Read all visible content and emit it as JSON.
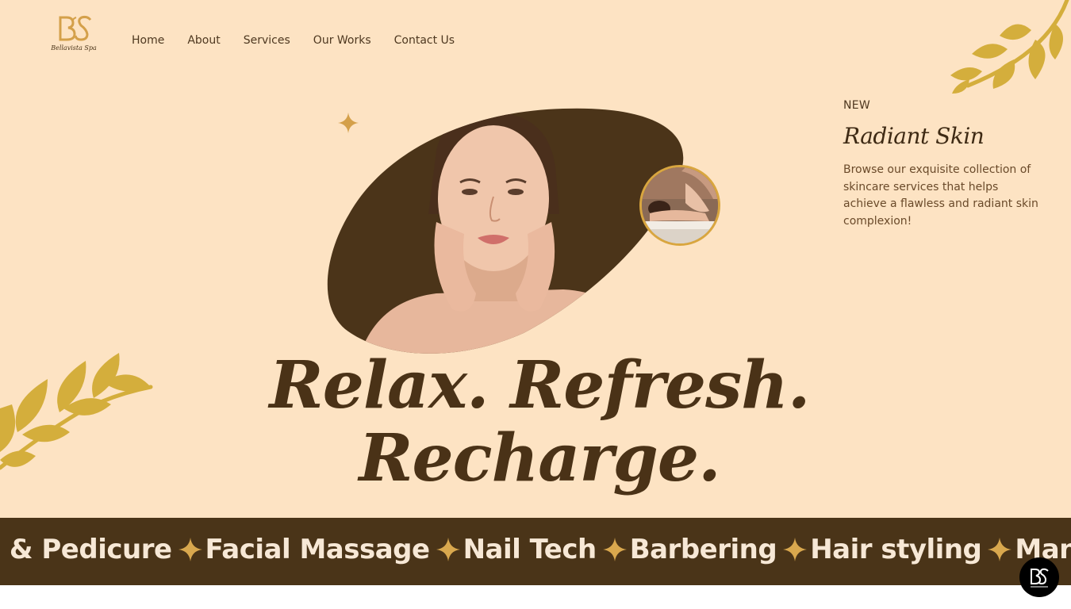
{
  "brand": {
    "monogram": "BS",
    "name": "Bellavista Spa"
  },
  "nav": {
    "items": [
      {
        "label": "Home"
      },
      {
        "label": "About"
      },
      {
        "label": "Services"
      },
      {
        "label": "Our Works"
      },
      {
        "label": "Contact Us"
      }
    ]
  },
  "promo": {
    "tag": "NEW",
    "title": "Radiant Skin",
    "description": "Browse our exquisite collection of skincare services that helps achieve a flawless and radiant skin complexion!"
  },
  "hero": {
    "headline_line1": "Relax. Refresh.",
    "headline_line2": "Recharge."
  },
  "marquee": {
    "items": [
      {
        "label": "e & Pedicure"
      },
      {
        "label": "Facial Massage"
      },
      {
        "label": "Nail Tech"
      },
      {
        "label": "Barbering"
      },
      {
        "label": "Hair styling"
      },
      {
        "label": "Manicure"
      }
    ]
  },
  "colors": {
    "hero_bg": "#fde3c3",
    "dark_brown": "#4a3418",
    "gold": "#d4ae3c",
    "text_brown": "#4e3820"
  },
  "icons": {
    "leaf": "leaf-branch-icon",
    "sparkle": "sparkle-star-icon",
    "chat": "chat-badge-icon"
  }
}
